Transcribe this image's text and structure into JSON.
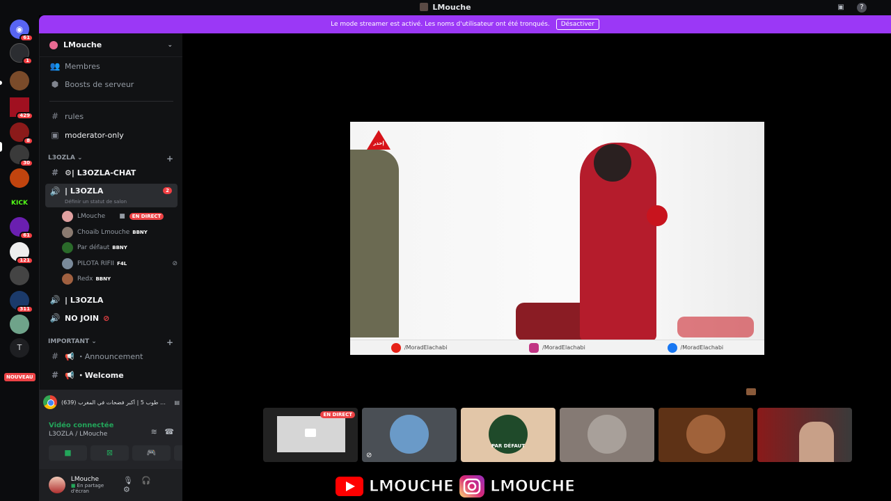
{
  "window": {
    "title": "LMouche"
  },
  "banner": {
    "text": "Le mode streamer est activé. Les noms d'utilisateur ont été tronqués.",
    "button": "Désactiver"
  },
  "guilds": [
    {
      "name": "home",
      "badge": "61",
      "color": "#5865f2"
    },
    {
      "name": "server-1",
      "badge": "1",
      "color": "#2b2d31"
    },
    {
      "name": "server-2",
      "badge": "",
      "color": "#7a4b2a"
    },
    {
      "name": "server-3",
      "badge": "429",
      "color": "#a01020"
    },
    {
      "name": "server-4",
      "badge": "8",
      "color": "#8b1a1a"
    },
    {
      "name": "server-5",
      "badge": "30",
      "color": "#3a3a3a"
    },
    {
      "name": "server-6",
      "badge": "",
      "color": "#c1440e"
    },
    {
      "name": "kick",
      "badge": "",
      "color": "#0b0c0e",
      "label": "KICK"
    },
    {
      "name": "server-8",
      "badge": "61",
      "color": "#6a1fb0"
    },
    {
      "name": "server-9",
      "badge": "121",
      "color": "#eeeeee"
    },
    {
      "name": "server-10",
      "badge": "",
      "color": "#444"
    },
    {
      "name": "server-11",
      "badge": "311",
      "color": "#1b3a6a"
    },
    {
      "name": "server-12",
      "badge": "",
      "color": "#6fa38a"
    },
    {
      "name": "server-t",
      "badge": "",
      "color": "#1e1f22",
      "label": "T"
    }
  ],
  "new_badge": "NOUVEAU",
  "server": {
    "name": "LMouche"
  },
  "top_links": [
    {
      "label": "Membres"
    },
    {
      "label": "Boosts de serveur"
    }
  ],
  "channels_top": [
    {
      "label": "rules"
    },
    {
      "label": "moderator-only"
    }
  ],
  "category_1": "L3OZLA",
  "channels_1": [
    {
      "label": "⚙| L3OZLA-CHAT"
    }
  ],
  "voice_active": {
    "label": "| L3OZLA",
    "status": "Définir un statut de salon",
    "badge": "2"
  },
  "voice_users": [
    {
      "name": "LMouche",
      "tag": "",
      "live": "EN DIRECT",
      "color": "#e0a0a0"
    },
    {
      "name": "Choaib Lmouche",
      "tag": "BBNY",
      "live": "",
      "color": "#8a7a70"
    },
    {
      "name": "Par défaut",
      "tag": "BBNY",
      "live": "",
      "color": "#2a6a2a"
    },
    {
      "name": "PILOTA RIFII",
      "tag": "F4L",
      "live": "",
      "color": "#7a8a9a"
    },
    {
      "name": "Redx",
      "tag": "BBNY",
      "live": "",
      "color": "#a06040"
    }
  ],
  "voice_channels": [
    {
      "label": "| L3OZLA"
    },
    {
      "label": "NO JOIN"
    }
  ],
  "category_2": "IMPORTANT",
  "channels_2": [
    {
      "label": "・Announcement"
    },
    {
      "label": "・Welcome"
    }
  ],
  "activity": {
    "text": "(639) طوب 5 | أكبر فضحات في المغرب 🤣🤣 - Y..."
  },
  "voice_panel": {
    "status": "Vidéo connectée",
    "channel": "L3OZLA / LMouche"
  },
  "user": {
    "name": "LMouche",
    "status": "En partage d'écran"
  },
  "video": {
    "socials": [
      "/MoradElachabi",
      "/MoradElachabi",
      "/MoradElachabi"
    ],
    "logo_text": "إحذر"
  },
  "tiles": [
    {
      "live": "EN DIRECT"
    },
    {},
    {
      "label": "PAR DÉFAUT"
    },
    {},
    {},
    {}
  ],
  "brand": {
    "text1": "LMOUCHE",
    "text2": "LMOUCHE"
  },
  "colors": {
    "accent": "#9b38f6",
    "live": "#ed4245",
    "online": "#23a55a"
  }
}
